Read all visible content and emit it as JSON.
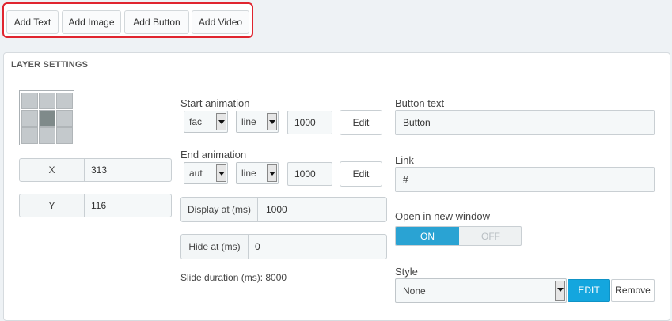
{
  "toolbar": {
    "add_text": "Add Text",
    "add_image": "Add Image",
    "add_button": "Add Button",
    "add_video": "Add Video"
  },
  "panel": {
    "title": "LAYER SETTINGS",
    "position": {
      "x_label": "X",
      "x_value": "313",
      "y_label": "Y",
      "y_value": "116"
    },
    "start_animation": {
      "label": "Start animation",
      "effect": "fac",
      "easing": "line",
      "duration": "1000",
      "edit": "Edit"
    },
    "end_animation": {
      "label": "End animation",
      "effect": "aut",
      "easing": "line",
      "duration": "1000",
      "edit": "Edit"
    },
    "display_at": {
      "label": "Display at (ms)",
      "value": "1000"
    },
    "hide_at": {
      "label": "Hide at (ms)",
      "value": "0"
    },
    "slide_duration": "Slide duration (ms): 8000",
    "button_text": {
      "label": "Button text",
      "value": "Button"
    },
    "link": {
      "label": "Link",
      "value": "#"
    },
    "new_window": {
      "label": "Open in new window",
      "on": "ON",
      "off": "OFF"
    },
    "style": {
      "label": "Style",
      "value": "None",
      "edit": "EDIT",
      "remove": "Remove"
    }
  }
}
